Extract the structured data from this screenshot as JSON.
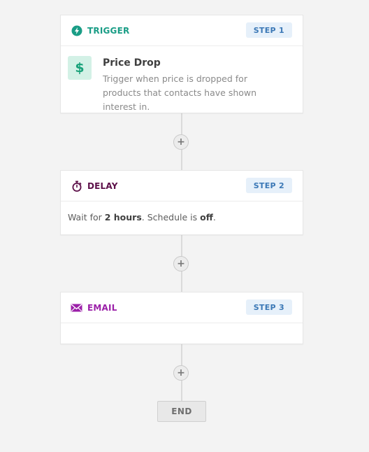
{
  "colors": {
    "trigger": "#1a9d86",
    "delay": "#5d1049",
    "email": "#9b1fa8",
    "step_badge_bg": "#e6f0fa",
    "step_badge_text": "#3b78b6"
  },
  "trigger_card": {
    "icon": "lightning-icon",
    "label": "TRIGGER",
    "step": "STEP 1",
    "item_icon": "dollar-icon",
    "item_icon_glyph": "$",
    "title": "Price Drop",
    "description": "Trigger when price is dropped for products that contacts have shown interest in."
  },
  "delay_card": {
    "icon": "stopwatch-icon",
    "label": "DELAY",
    "step": "STEP 2",
    "text_prefix": "Wait for ",
    "duration": "2 hours",
    "text_middle": ". Schedule is ",
    "schedule": "off",
    "text_suffix": "."
  },
  "email_card": {
    "icon": "envelope-icon",
    "label": "EMAIL",
    "step": "STEP 3"
  },
  "add_step_glyph": "+",
  "end_label": "END"
}
